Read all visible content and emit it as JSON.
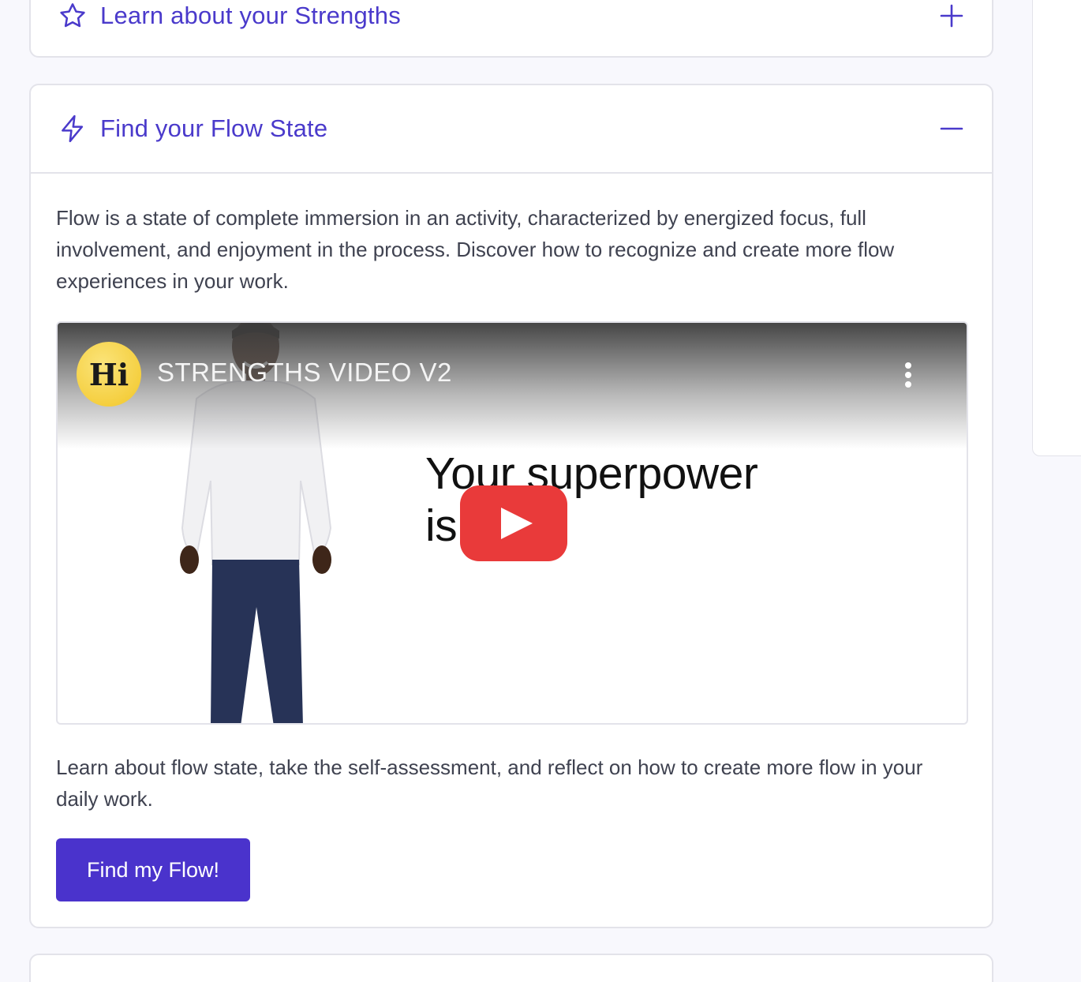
{
  "colors": {
    "accent": "#4a3acb",
    "button": "#4a33cc",
    "text": "#3f4250",
    "border": "#e3e3ea",
    "background": "#f8f8fd",
    "youtube_red": "#e93a3a"
  },
  "sections": {
    "strengths": {
      "title": "Learn about your Strengths",
      "icon": "star-icon",
      "toggle_icon": "plus-icon",
      "expanded": false
    },
    "flow": {
      "title": "Find your Flow State",
      "icon": "lightning-icon",
      "toggle_icon": "minus-icon",
      "expanded": true,
      "description": "Flow is a state of complete immersion in an activity, characterized by energized focus, full involvement, and enjoyment in the process. Discover how to recognize and create more flow experiences in your work.",
      "video": {
        "channel_logo": "Hi",
        "title": "STRENGTHS VIDEO V2",
        "overlay_text_line1": "Your superpower",
        "overlay_text_line2": "is",
        "menu_icon": "more-vertical-icon",
        "play_icon": "youtube-play-icon"
      },
      "cta_text": "Learn about flow state, take the self-assessment, and reflect on how to create more flow in your daily work.",
      "cta_button": "Find my Flow!"
    }
  }
}
